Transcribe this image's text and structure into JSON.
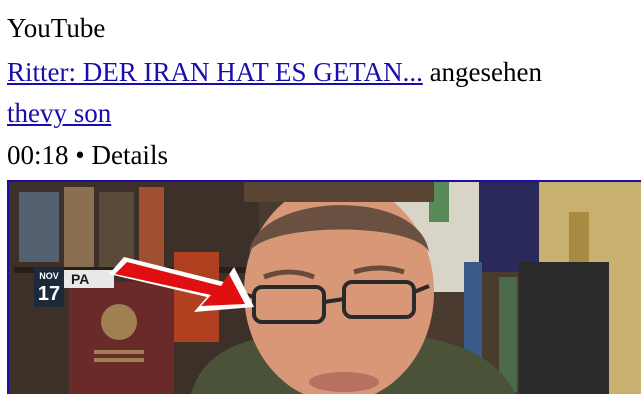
{
  "source": "YouTube",
  "history_item": {
    "title": "Ritter: DER IRAN HAT ES GETAN...",
    "action": "angesehen",
    "channel": "thevy son",
    "time": "00:18",
    "separator": "•",
    "details_label": "Details"
  },
  "thumbnail": {
    "overlay_date_month": "NOV",
    "overlay_date_day": "17",
    "overlay_text": "PA",
    "arrow_color": "#e01010"
  }
}
